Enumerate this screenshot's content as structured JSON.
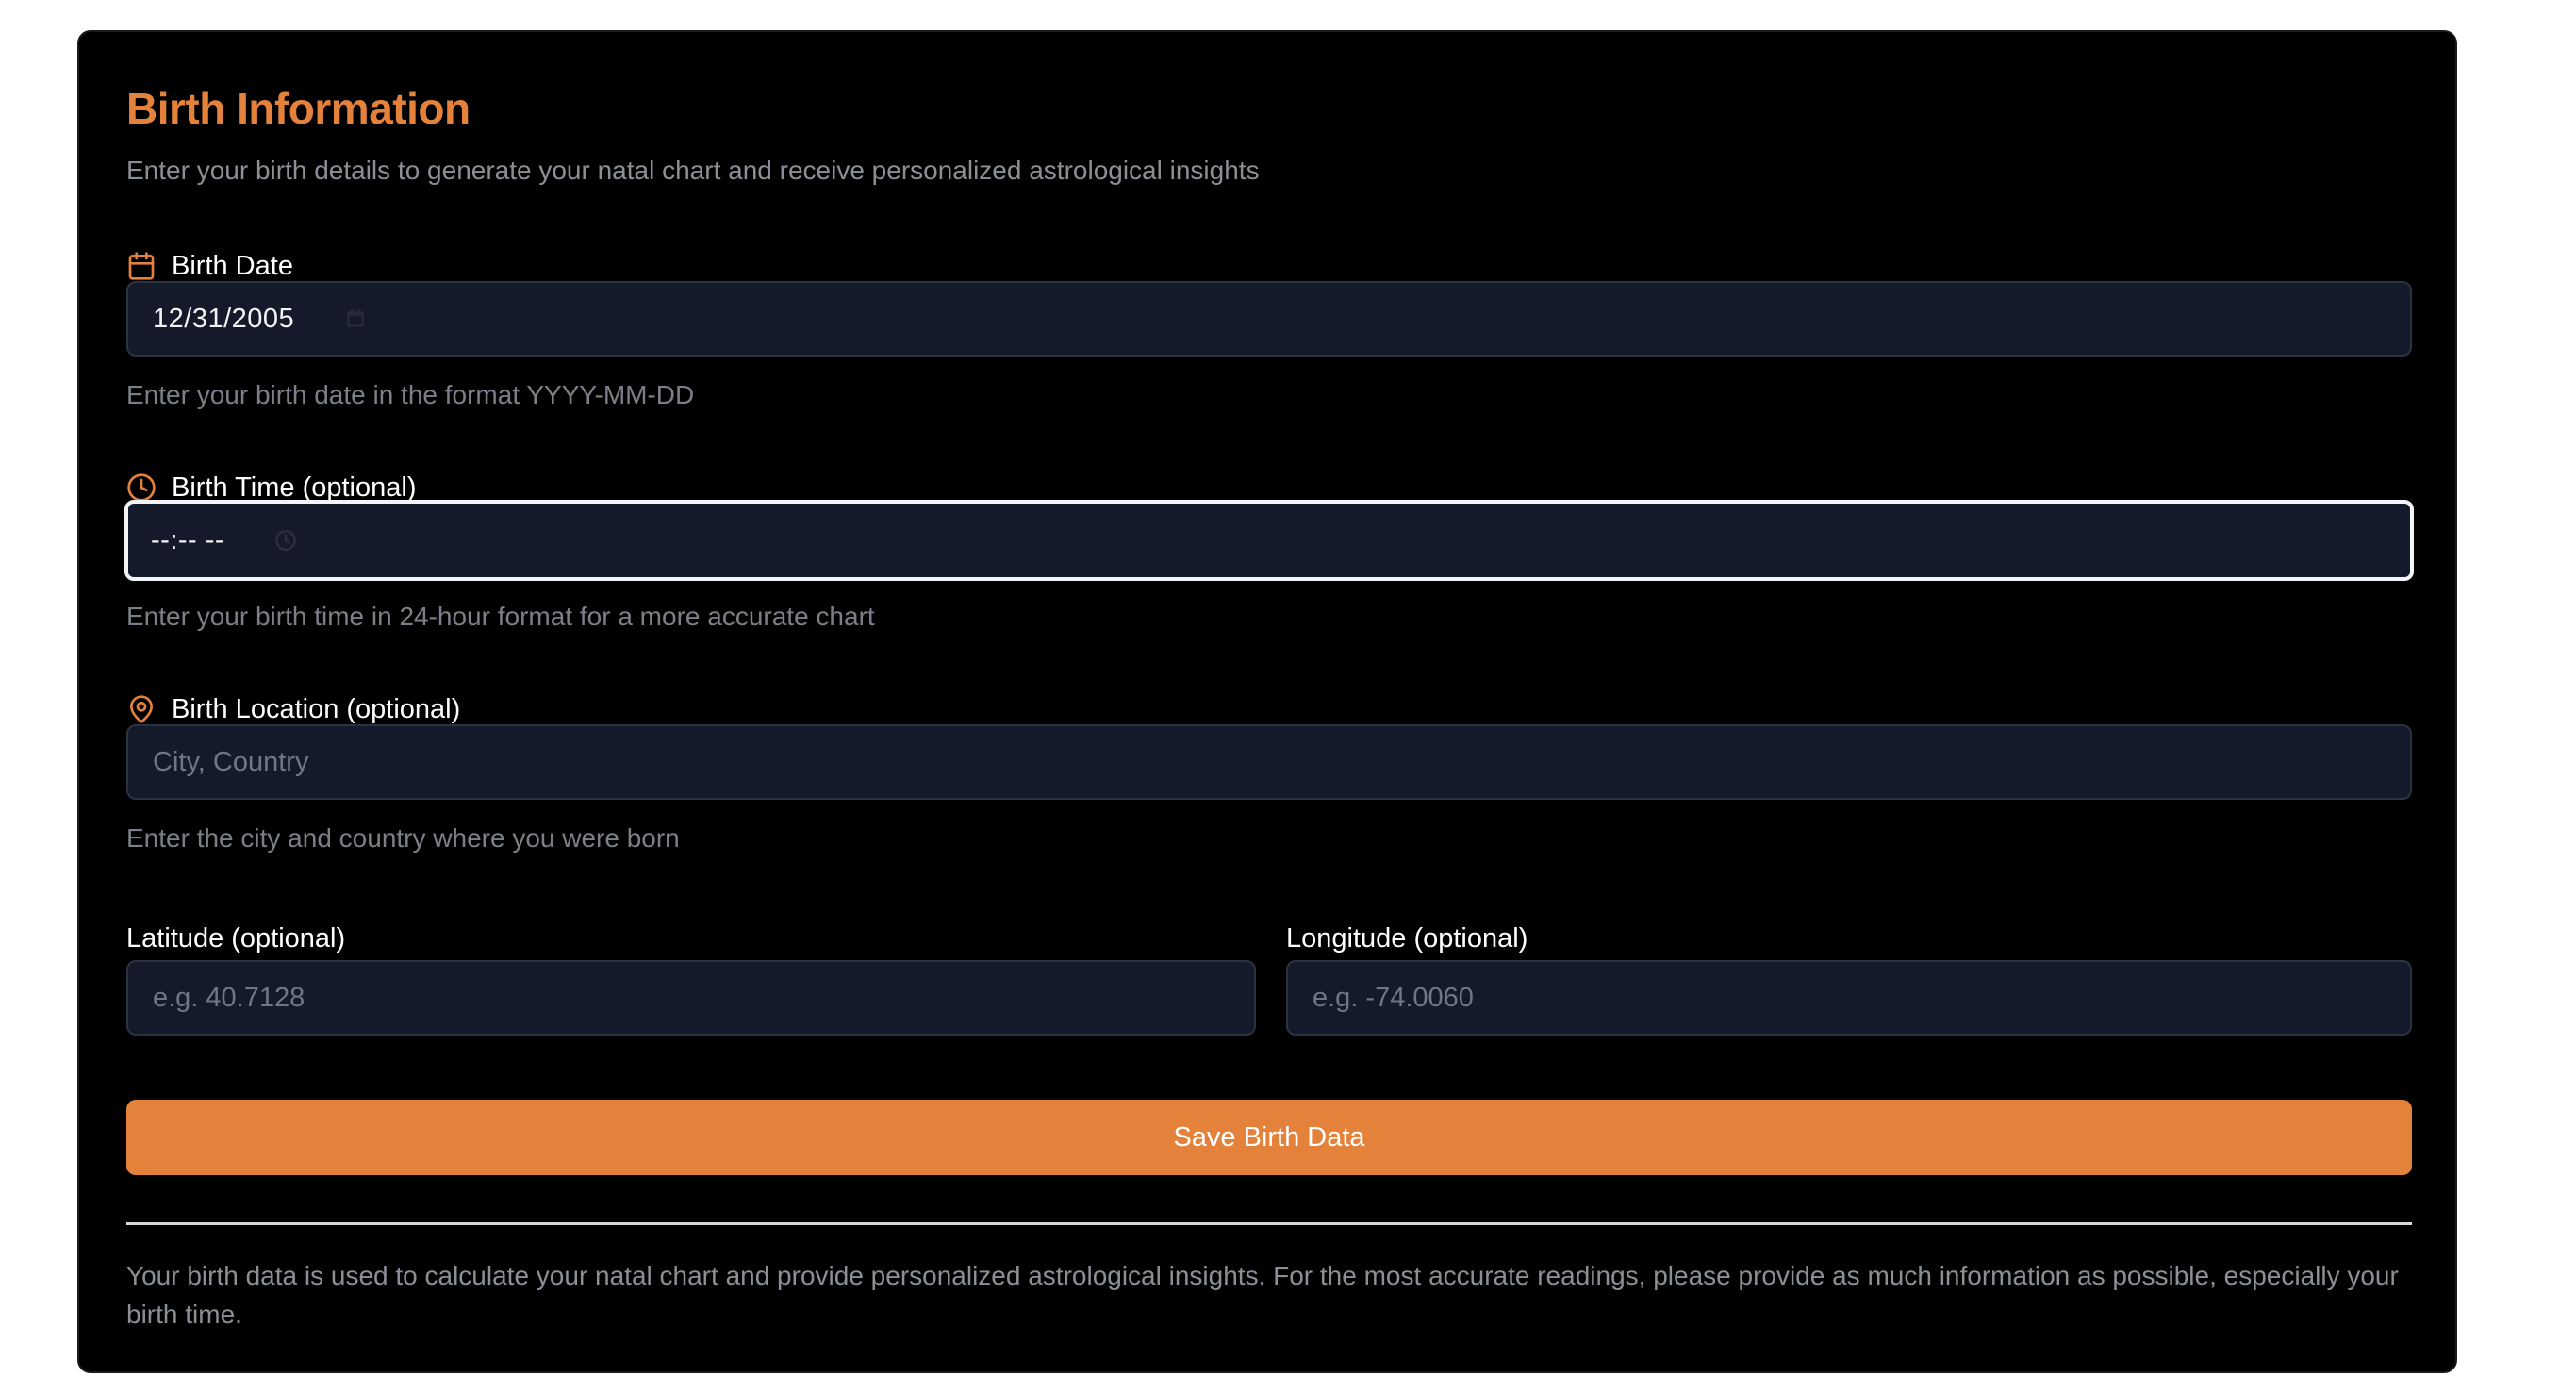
{
  "header": {
    "title": "Birth Information",
    "subtitle": "Enter your birth details to generate your natal chart and receive personalized astrological insights"
  },
  "birth_date": {
    "label": "Birth Date",
    "icon": "calendar-icon",
    "value": "12/31/2005",
    "picker_icon": "calendar-icon",
    "help": "Enter your birth date in the format YYYY-MM-DD"
  },
  "birth_time": {
    "label": "Birth Time (optional)",
    "icon": "clock-icon",
    "value": "--:-- --",
    "picker_icon": "clock-icon",
    "help": "Enter your birth time in 24-hour format for a more accurate chart"
  },
  "birth_location": {
    "label": "Birth Location (optional)",
    "icon": "map-pin-icon",
    "placeholder": "City, Country",
    "help": "Enter the city and country where you were born"
  },
  "latitude": {
    "label": "Latitude (optional)",
    "placeholder": "e.g. 40.7128"
  },
  "longitude": {
    "label": "Longitude (optional)",
    "placeholder": "e.g. -74.0060"
  },
  "actions": {
    "save_label": "Save Birth Data"
  },
  "footer": {
    "note": "Your birth data is used to calculate your natal chart and provide personalized astrological insights. For the most accurate readings, please provide as much information as possible, especially your birth time."
  },
  "colors": {
    "accent": "#e4813a",
    "background": "#000000",
    "input_background": "#141a29",
    "input_border": "#2b3242",
    "focus_border": "#f3f4f6",
    "muted_text": "#8b8f96"
  }
}
